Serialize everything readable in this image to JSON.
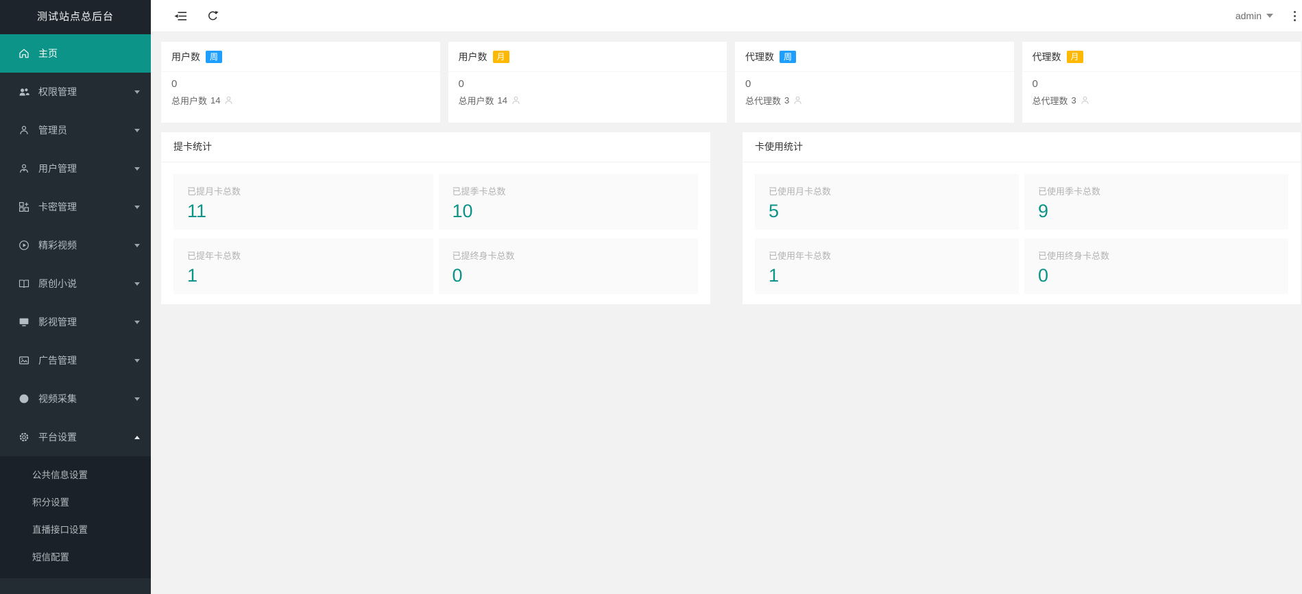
{
  "app": {
    "title": "测试站点总后台"
  },
  "topbar": {
    "username": "admin"
  },
  "sidebar": {
    "items": [
      {
        "label": "主页",
        "icon": "home-icon",
        "active": true
      },
      {
        "label": "权限管理",
        "icon": "users-icon"
      },
      {
        "label": "管理员",
        "icon": "admin-icon"
      },
      {
        "label": "用户管理",
        "icon": "user-icon"
      },
      {
        "label": "卡密管理",
        "icon": "cards-icon"
      },
      {
        "label": "精彩视频",
        "icon": "play-circle-icon"
      },
      {
        "label": "原创小说",
        "icon": "book-icon"
      },
      {
        "label": "影视管理",
        "icon": "monitor-icon"
      },
      {
        "label": "广告管理",
        "icon": "picture-icon"
      },
      {
        "label": "视频采集",
        "icon": "dot-circle-icon"
      },
      {
        "label": "平台设置",
        "icon": "gear-icon",
        "expanded": true,
        "children": [
          "公共信息设置",
          "积分设置",
          "直播接口设置",
          "短信配置"
        ]
      }
    ]
  },
  "stat_cards": [
    {
      "title": "用户数",
      "badge": "周",
      "value": "0",
      "total_label": "总用户数",
      "total_value": "14"
    },
    {
      "title": "用户数",
      "badge": "月",
      "value": "0",
      "total_label": "总用户数",
      "total_value": "14"
    },
    {
      "title": "代理数",
      "badge": "周",
      "value": "0",
      "total_label": "总代理数",
      "total_value": "3"
    },
    {
      "title": "代理数",
      "badge": "月",
      "value": "0",
      "total_label": "总代理数",
      "total_value": "3"
    }
  ],
  "panels": [
    {
      "title": "提卡统计",
      "boxes": [
        {
          "label": "已提月卡总数",
          "value": "11"
        },
        {
          "label": "已提季卡总数",
          "value": "10"
        },
        {
          "label": "已提年卡总数",
          "value": "1"
        },
        {
          "label": "已提终身卡总数",
          "value": "0"
        }
      ]
    },
    {
      "title": "卡使用统计",
      "boxes": [
        {
          "label": "已使用月卡总数",
          "value": "5"
        },
        {
          "label": "已使用季卡总数",
          "value": "9"
        },
        {
          "label": "已使用年卡总数",
          "value": "1"
        },
        {
          "label": "已使用终身卡总数",
          "value": "0"
        }
      ]
    }
  ],
  "colors": {
    "sidebar_bg": "#232b33",
    "submenu_bg": "#1a2128",
    "accent_teal": "#0d9488",
    "badge_week_blue": "#1E9FFF",
    "badge_month_yellow": "#FFB800",
    "stat_number_teal": "#0d9488",
    "content_bg": "#f2f2f2"
  }
}
